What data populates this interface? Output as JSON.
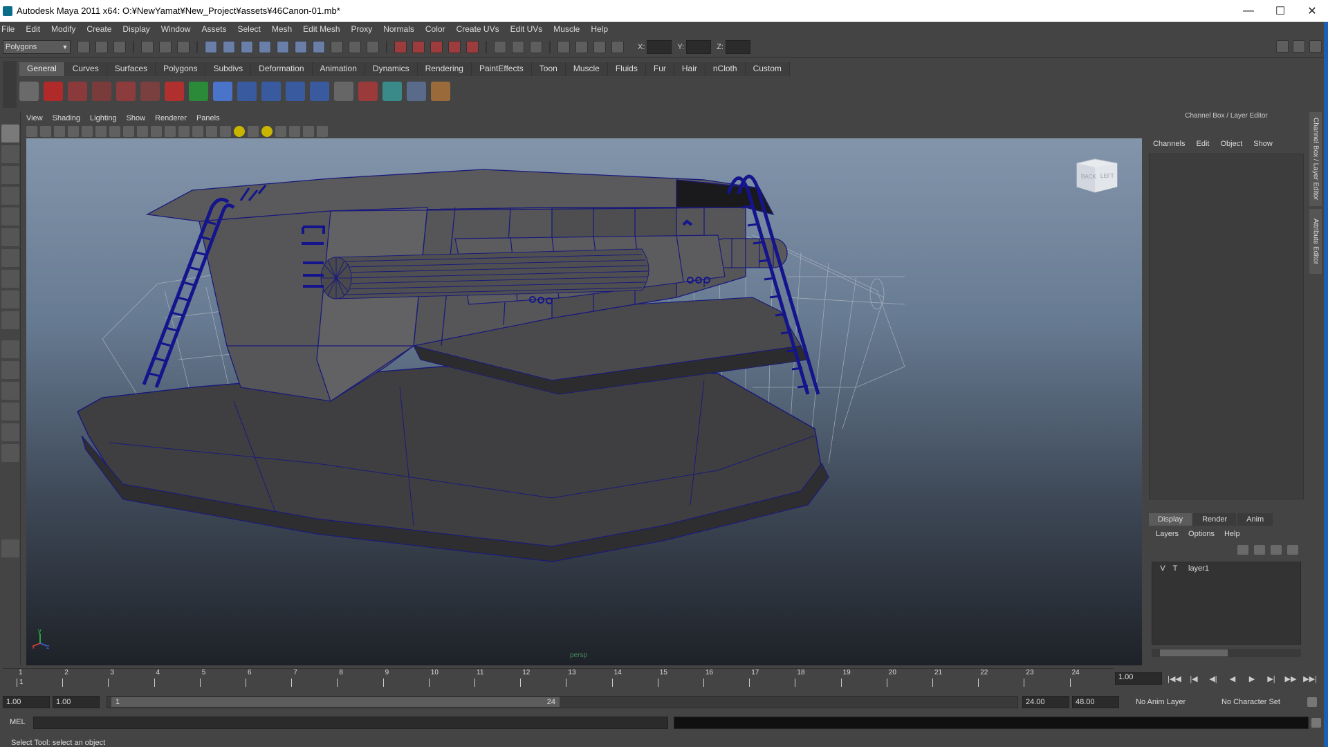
{
  "window": {
    "title": "Autodesk Maya 2011 x64: O:¥NewYamat¥New_Project¥assets¥46Canon-01.mb*",
    "minimize": "—",
    "maximize": "☐",
    "close": "✕"
  },
  "menubar": [
    "File",
    "Edit",
    "Modify",
    "Create",
    "Display",
    "Window",
    "Assets",
    "Select",
    "Mesh",
    "Edit Mesh",
    "Proxy",
    "Normals",
    "Color",
    "Create UVs",
    "Edit UVs",
    "Muscle",
    "Help"
  ],
  "statusline": {
    "mode": "Polygons",
    "x_label": "X:",
    "y_label": "Y:",
    "z_label": "Z:"
  },
  "shelf": {
    "tabs": [
      "General",
      "Curves",
      "Surfaces",
      "Polygons",
      "Subdivs",
      "Deformation",
      "Animation",
      "Dynamics",
      "Rendering",
      "PaintEffects",
      "Toon",
      "Muscle",
      "Fluids",
      "Fur",
      "Hair",
      "nCloth",
      "Custom"
    ],
    "active_tab": "General",
    "icons": [
      "sphere-icon",
      "help-icon",
      "cloth-icon",
      "flare-icon",
      "brush-icon",
      "magnet-icon",
      "loop-icon",
      "arrow-icon",
      "ball-icon",
      "joint-icon",
      "skeleton-icon",
      "bones-icon",
      "chain-icon",
      "stack-icon",
      "paint-icon",
      "render-icon",
      "cube-icon",
      "pencil-icon"
    ]
  },
  "viewport": {
    "menu": [
      "View",
      "Shading",
      "Lighting",
      "Show",
      "Renderer",
      "Panels"
    ],
    "camera_label": "persp",
    "viewcube": {
      "back": "BACK",
      "left": "LEFT"
    },
    "axis": {
      "x": "x",
      "y": "y",
      "z": "z"
    }
  },
  "channel_box": {
    "title": "Channel Box / Layer Editor",
    "menu": [
      "Channels",
      "Edit",
      "Object",
      "Show"
    ],
    "side_tabs": [
      "Channel Box / Layer Editor",
      "Attribute Editor"
    ]
  },
  "layer_editor": {
    "tabs": [
      "Display",
      "Render",
      "Anim"
    ],
    "active_tab": "Display",
    "menu": [
      "Layers",
      "Options",
      "Help"
    ],
    "layers": [
      {
        "v": "V",
        "t": "T",
        "name": "layer1"
      }
    ]
  },
  "timeline": {
    "ticks": [
      "1",
      "2",
      "3",
      "4",
      "5",
      "6",
      "7",
      "8",
      "9",
      "10",
      "11",
      "12",
      "13",
      "14",
      "15",
      "16",
      "17",
      "18",
      "19",
      "20",
      "21",
      "22",
      "23",
      "24"
    ],
    "current_frame_marker": "1",
    "current_time": "1.00"
  },
  "range": {
    "start_time": "1.00",
    "playback_start": "1.00",
    "range_start_label": "1",
    "range_end_label": "24",
    "playback_end": "24.00",
    "end_time": "48.00",
    "anim_layer": "No Anim Layer",
    "character_set": "No Character Set"
  },
  "mel": {
    "label": "MEL"
  },
  "helpline": "Select Tool: select an object",
  "colors": {
    "wire_blue": "#1a1a7a",
    "ladder": "#14148c",
    "bg_top": "#8395ab",
    "bg_bottom": "#1e2228"
  }
}
